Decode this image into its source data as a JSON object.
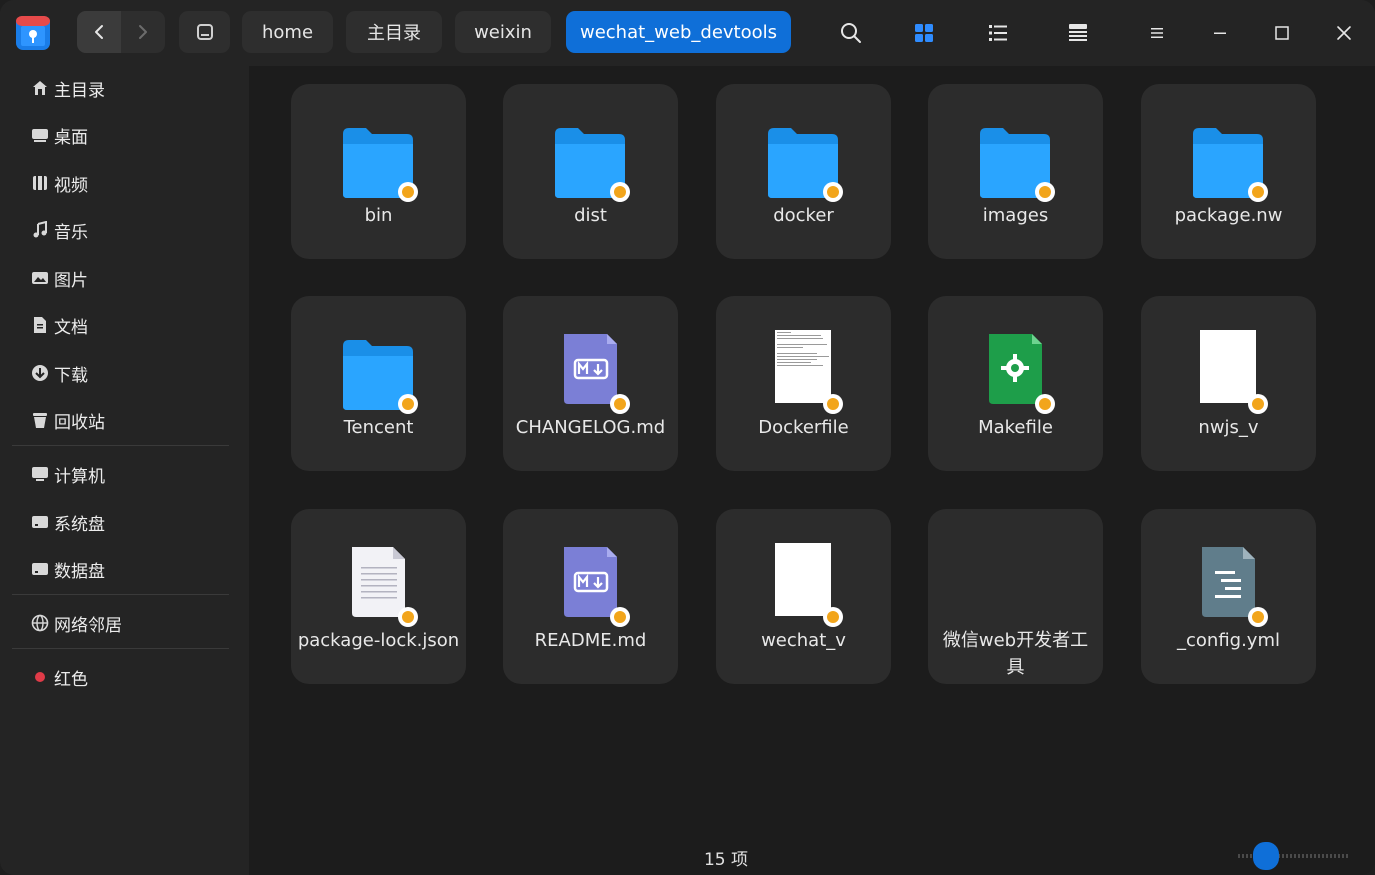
{
  "window": {
    "breadcrumbs": [
      "home",
      "主目录",
      "weixin",
      "wechat_web_devtools"
    ],
    "active_crumb": "wechat_web_devtools"
  },
  "toolbar": {
    "icons": [
      "search-icon",
      "icon-view-icon",
      "list-view-icon",
      "detail-view-icon",
      "menu-icon",
      "minimize-icon",
      "maximize-icon",
      "close-icon"
    ]
  },
  "sidebar": {
    "items": [
      {
        "label": "主目录",
        "icon": "home-icon"
      },
      {
        "label": "桌面",
        "icon": "desktop-icon"
      },
      {
        "label": "视频",
        "icon": "video-icon"
      },
      {
        "label": "音乐",
        "icon": "music-icon"
      },
      {
        "label": "图片",
        "icon": "picture-icon"
      },
      {
        "label": "文档",
        "icon": "document-icon"
      },
      {
        "label": "下载",
        "icon": "download-icon"
      },
      {
        "label": "回收站",
        "icon": "trash-icon"
      },
      {
        "label": "计算机",
        "icon": "computer-icon"
      },
      {
        "label": "系统盘",
        "icon": "disk-icon"
      },
      {
        "label": "数据盘",
        "icon": "disk-icon"
      },
      {
        "label": "网络邻居",
        "icon": "network-icon"
      },
      {
        "label": "红色",
        "icon": "red-tag-dot",
        "color": "#e03b48"
      }
    ]
  },
  "files": [
    {
      "name": "bin",
      "type": "folder"
    },
    {
      "name": "dist",
      "type": "folder"
    },
    {
      "name": "docker",
      "type": "folder"
    },
    {
      "name": "images",
      "type": "folder"
    },
    {
      "name": "package.nw",
      "type": "folder"
    },
    {
      "name": "Tencent",
      "type": "folder"
    },
    {
      "name": "CHANGELOG.md",
      "type": "markdown"
    },
    {
      "name": "Dockerfile",
      "type": "text-preview"
    },
    {
      "name": "Makefile",
      "type": "makefile"
    },
    {
      "name": "nwjs_v",
      "type": "blank-preview"
    },
    {
      "name": "package-lock.json",
      "type": "text-doc"
    },
    {
      "name": "README.md",
      "type": "markdown"
    },
    {
      "name": "wechat_v",
      "type": "blank-preview"
    },
    {
      "name": "微信web开发者工具",
      "type": "none"
    },
    {
      "name": "_config.yml",
      "type": "yaml"
    }
  ],
  "status": {
    "count_label": "15 项"
  },
  "colors": {
    "accent": "#0f6fd8",
    "folder": "#1a8fe8",
    "lock": "#f2a51b",
    "makefile": "#1e9e4a",
    "markdown": "#7b7fd6",
    "yaml": "#607d8b"
  }
}
